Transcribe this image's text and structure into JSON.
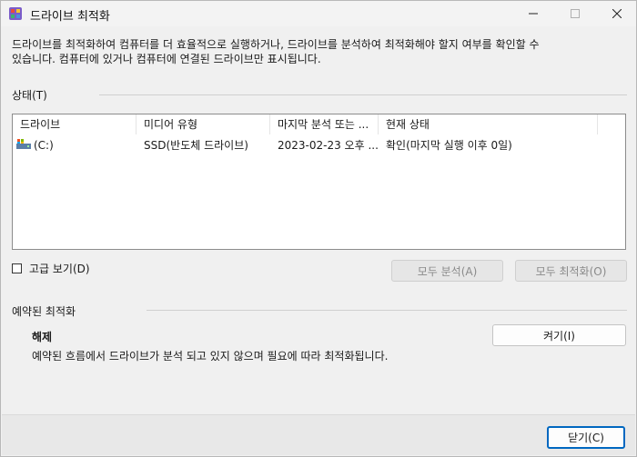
{
  "window": {
    "title": "드라이브 최적화",
    "icon": "defrag-app-icon"
  },
  "description": {
    "line1": "드라이브를 최적화하여 컴퓨터를 더 효율적으로 실행하거나, 드라이브를 분석하여 최적화해야 할지 여부를 확인할 수",
    "line2": "있습니다. 컴퓨터에 있거나 컴퓨터에 연결된 드라이브만 표시됩니다."
  },
  "status": {
    "label": "상태(T)",
    "columns": [
      "드라이브",
      "미디어 유형",
      "마지막 분석 또는 ...",
      "현재 상태"
    ],
    "rows": [
      {
        "drive": "(C:)",
        "media_type": "SSD(반도체 드라이브)",
        "last_run": "2023-02-23 오후 ...",
        "current_status": "확인(마지막 실행 이후 0일)"
      }
    ]
  },
  "advanced_view": {
    "label": "고급 보기(D)",
    "checked": false
  },
  "buttons": {
    "analyze_all": "모두 분석(A)",
    "optimize_all": "모두 최적화(O)",
    "turn_on": "켜기(I)",
    "close": "닫기(C)"
  },
  "scheduled": {
    "section_label": "예약된 최적화",
    "state": "해제",
    "description": "예약된 흐름에서 드라이브가 분석 되고 있지 않으며 필요에 따라 최적화됩니다."
  },
  "colors": {
    "accent": "#0067c0",
    "window_bg": "#f0f0f0"
  }
}
